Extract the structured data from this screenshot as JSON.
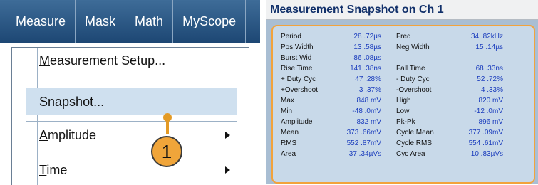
{
  "menubar": {
    "items": [
      "Measure",
      "Mask",
      "Math",
      "MyScope"
    ]
  },
  "dropdown": {
    "items": [
      {
        "pre": "",
        "acc": "M",
        "post": "easurement Setup...",
        "submenu": false
      },
      {
        "pre": "S",
        "acc": "n",
        "post": "apshot...",
        "submenu": false
      },
      {
        "pre": "",
        "acc": "A",
        "post": "mplitude",
        "submenu": true
      },
      {
        "pre": "",
        "acc": "T",
        "post": "ime",
        "submenu": true
      }
    ]
  },
  "callout": {
    "number": "1"
  },
  "snapshot": {
    "title": "Measurement Snapshot on Ch 1",
    "rows": [
      {
        "l_label": "Period",
        "l_value": "28 .72µs",
        "r_label": "Freq",
        "r_value": "34 .82kHz"
      },
      {
        "l_label": "Pos Width",
        "l_value": "13 .58µs",
        "r_label": "Neg Width",
        "r_value": "15 .14µs"
      },
      {
        "l_label": "Burst Wid",
        "l_value": "86 .08µs",
        "r_label": "",
        "r_value": ""
      },
      {
        "l_label": "Rise Time",
        "l_value": "141 .38ns",
        "r_label": "Fall Time",
        "r_value": "68 .33ns"
      },
      {
        "l_label": "+ Duty Cyc",
        "l_value": "47 .28%",
        "r_label": "- Duty Cyc",
        "r_value": "52 .72%"
      },
      {
        "l_label": "+Overshoot",
        "l_value": "3 .37%",
        "r_label": "-Overshoot",
        "r_value": "4 .33%"
      },
      {
        "l_label": "Max",
        "l_value": "848 mV",
        "r_label": "High",
        "r_value": "820 mV"
      },
      {
        "l_label": "Min",
        "l_value": "-48 .0mV",
        "r_label": "Low",
        "r_value": "-12 .0mV"
      },
      {
        "l_label": "Amplitude",
        "l_value": "832 mV",
        "r_label": "Pk-Pk",
        "r_value": "896 mV"
      },
      {
        "l_label": "Mean",
        "l_value": "373 .66mV",
        "r_label": "Cycle Mean",
        "r_value": "377 .09mV"
      },
      {
        "l_label": "RMS",
        "l_value": "552 .87mV",
        "r_label": "Cycle RMS",
        "r_value": "554 .61mV"
      },
      {
        "l_label": "Area",
        "l_value": "37 .34µVs",
        "r_label": "Cyc Area",
        "r_value": "10 .83µVs"
      }
    ]
  }
}
